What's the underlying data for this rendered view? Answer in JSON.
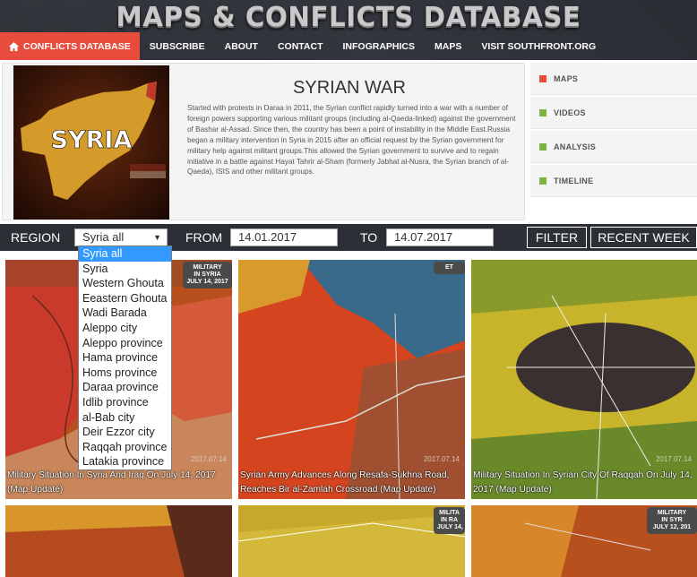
{
  "header": {
    "site_title": "MAPS & CONFLICTS DATABASE",
    "nav": [
      {
        "label": "CONFLICTS DATABASE",
        "icon": "home-icon",
        "active": true
      },
      {
        "label": "SUBSCRIBE"
      },
      {
        "label": "ABOUT"
      },
      {
        "label": "CONTACT"
      },
      {
        "label": "INFOGRAPHICS"
      },
      {
        "label": "MAPS"
      },
      {
        "label": "VISIT SOUTHFRONT.ORG"
      }
    ]
  },
  "conflict": {
    "thumb_text": "SYRIA",
    "title": "SYRIAN WAR",
    "description": "Started with protests in Daraa in 2011, the Syrian conflict rapidly turned into a war with a number of foreign powers supporting various militant groups (including al-Qaeda-linked) against the government of Bashar al-Assad. Since then, the country has been a point of instability in the Middle East.Russia began a military intervention in Syria in 2015 after an official request by the Syrian government for military help against militant groups.This allowed the Syrian government to survive and to regain initiative in a battle against Hayat Tahrir al-Sham (formerly Jabhat al-Nusra, the Syrian branch of al-Qaeda), ISIS and other militant groups."
  },
  "sidebar": {
    "items": [
      {
        "label": "MAPS",
        "color": "#e74c3c"
      },
      {
        "label": "VIDEOS",
        "color": "#7cb342"
      },
      {
        "label": "ANALYSIS",
        "color": "#7cb342"
      },
      {
        "label": "TIMELINE",
        "color": "#7cb342"
      }
    ]
  },
  "filter": {
    "region_label": "REGION",
    "region_value": "Syria all",
    "from_label": "FROM",
    "from_value": "14.01.2017",
    "to_label": "TO",
    "to_value": "14.07.2017",
    "filter_button": "FILTER",
    "recent_week_button": "RECENT WEEK",
    "region_options": [
      "Syria all",
      "Syria",
      "Western Ghouta",
      "Eeastern Ghouta",
      "Wadi Barada",
      "Aleppo city",
      "Aleppo province",
      "Hama province",
      "Homs province",
      "Daraa province",
      "Idlib province",
      "al-Bab city",
      "Deir Ezzor city",
      "Raqqah province",
      "Latakia province"
    ]
  },
  "cards": [
    {
      "title": "Military Situation In Syria And Iraq On July 14, 2017 (Map Update)",
      "date": "2017.07.14",
      "badge": "MILITARY\nIN SYRIA\nJULY 14, 2017"
    },
    {
      "title": "Syrian Army Advances Along Resafa-Sukhna Road, Reaches Bir al-Zamlah Crossroad (Map Update)",
      "date": "2017.07.14",
      "badge": "ET"
    },
    {
      "title": "Military Situation In Syrian City Of Raqqah On July 14, 2017 (Map Update)",
      "date": "2017.07.14",
      "badge": ""
    },
    {
      "title": "",
      "date": "",
      "badge": ""
    },
    {
      "title": "",
      "date": "",
      "badge": "MILITA\nIN RA\nJULY 14,"
    },
    {
      "title": "",
      "date": "",
      "badge": "MILITARY\nIN SYR\nJULY 12, 201"
    }
  ]
}
